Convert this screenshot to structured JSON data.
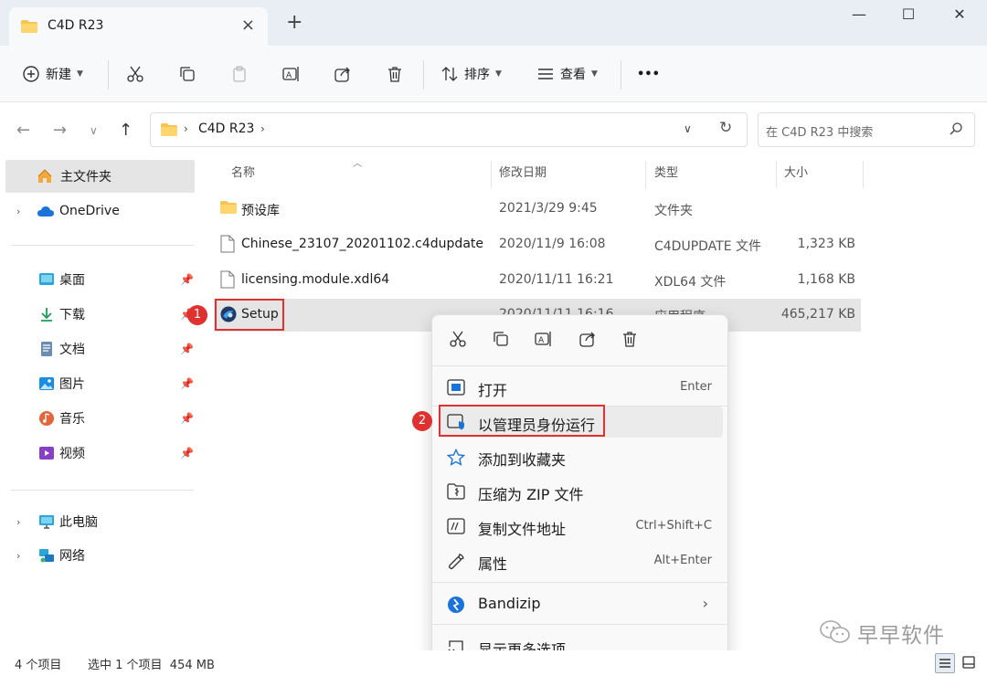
{
  "window": {
    "tab_title": "C4D R23",
    "new_tab": "+",
    "controls": {
      "minimize": "—",
      "maximize": "☐",
      "close": "✕"
    }
  },
  "commandbar": {
    "new_label": "新建",
    "sort_label": "排序",
    "view_label": "查看",
    "more": "•••"
  },
  "address": {
    "path": "C4D R23",
    "search_placeholder": "在 C4D R23 中搜索"
  },
  "sidebar": {
    "home": "主文件夹",
    "onedrive": "OneDrive",
    "quick": [
      {
        "label": "桌面",
        "icon": "desktop-icon"
      },
      {
        "label": "下载",
        "icon": "download-icon"
      },
      {
        "label": "文档",
        "icon": "document-icon"
      },
      {
        "label": "图片",
        "icon": "pictures-icon"
      },
      {
        "label": "音乐",
        "icon": "music-icon"
      },
      {
        "label": "视频",
        "icon": "video-icon"
      }
    ],
    "this_pc": "此电脑",
    "network": "网络"
  },
  "columns": {
    "name": "名称",
    "modified": "修改日期",
    "type": "类型",
    "size": "大小"
  },
  "files": [
    {
      "name": "预设库",
      "modified": "2021/3/29 9:45",
      "type": "文件夹",
      "size": "",
      "icon": "folder-icon"
    },
    {
      "name": "Chinese_23107_20201102.c4dupdate",
      "modified": "2020/11/9 16:08",
      "type": "C4DUPDATE 文件",
      "size": "1,323 KB",
      "icon": "file-icon"
    },
    {
      "name": "licensing.module.xdl64",
      "modified": "2020/11/11 16:21",
      "type": "XDL64 文件",
      "size": "1,168 KB",
      "icon": "file-icon"
    },
    {
      "name": "Setup",
      "modified": "2020/11/11 16:16",
      "type": "应用程序",
      "size": "465,217 KB",
      "icon": "setup-icon"
    }
  ],
  "badges": {
    "first": "1",
    "second": "2"
  },
  "context_menu": {
    "items": [
      {
        "label": "打开",
        "shortcut": "Enter"
      },
      {
        "label": "以管理员身份运行",
        "shortcut": ""
      },
      {
        "label": "添加到收藏夹",
        "shortcut": ""
      },
      {
        "label": "压缩为 ZIP 文件",
        "shortcut": ""
      },
      {
        "label": "复制文件地址",
        "shortcut": "Ctrl+Shift+C"
      },
      {
        "label": "属性",
        "shortcut": "Alt+Enter"
      }
    ],
    "bandizip": "Bandizip",
    "more_options": "显示更多选项"
  },
  "status": {
    "count": "4 个项目",
    "selected": "选中 1 个项目  454 MB"
  },
  "watermark": "早早软件",
  "colors": {
    "accent": "#0067c0",
    "highlight": "#e03131",
    "folder": "#f6c453"
  }
}
